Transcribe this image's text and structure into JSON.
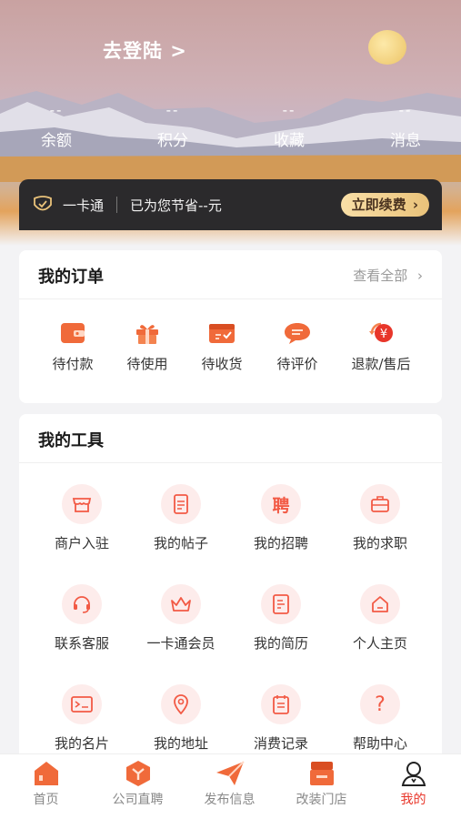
{
  "header": {
    "login_label": "去登陆 >",
    "stats": [
      {
        "value": "--",
        "label": "余额"
      },
      {
        "value": "--",
        "label": "积分"
      },
      {
        "value": "--",
        "label": "收藏"
      },
      {
        "value": "--",
        "label": "消息"
      }
    ]
  },
  "vip_bar": {
    "card_label": "一卡通",
    "savings_text": "已为您节省--元",
    "renew_button": "立即续费"
  },
  "orders": {
    "title": "我的订单",
    "see_all": "查看全部",
    "items": [
      {
        "label": "待付款",
        "icon": "wallet-icon"
      },
      {
        "label": "待使用",
        "icon": "gift-icon"
      },
      {
        "label": "待收货",
        "icon": "package-icon"
      },
      {
        "label": "待评价",
        "icon": "comment-icon"
      },
      {
        "label": "退款/售后",
        "icon": "refund-icon"
      }
    ]
  },
  "tools": {
    "title": "我的工具",
    "items": [
      {
        "label": "商户入驻",
        "icon": "shop-icon"
      },
      {
        "label": "我的帖子",
        "icon": "document-icon"
      },
      {
        "label": "我的招聘",
        "icon": "recruit-icon",
        "glyph": "聘"
      },
      {
        "label": "我的求职",
        "icon": "briefcase-icon"
      },
      {
        "label": "联系客服",
        "icon": "headset-icon"
      },
      {
        "label": "一卡通会员",
        "icon": "crown-icon"
      },
      {
        "label": "我的简历",
        "icon": "resume-icon"
      },
      {
        "label": "个人主页",
        "icon": "home-icon"
      },
      {
        "label": "我的名片",
        "icon": "id-card-icon"
      },
      {
        "label": "我的地址",
        "icon": "location-icon"
      },
      {
        "label": "消费记录",
        "icon": "receipt-icon"
      },
      {
        "label": "帮助中心",
        "icon": "help-icon",
        "glyph": "?"
      }
    ]
  },
  "tabbar": {
    "tabs": [
      {
        "label": "首页",
        "icon": "home-tab-icon"
      },
      {
        "label": "公司直聘",
        "icon": "company-tab-icon"
      },
      {
        "label": "发布信息",
        "icon": "send-tab-icon"
      },
      {
        "label": "改装门店",
        "icon": "store-tab-icon"
      },
      {
        "label": "我的",
        "icon": "profile-tab-icon"
      }
    ],
    "active_index": 4
  },
  "colors": {
    "accent": "#e8362a",
    "tool_bg": "#fdeceb",
    "vip_bg": "#2b2a2c",
    "renew_gold": "#f1cf8a"
  }
}
